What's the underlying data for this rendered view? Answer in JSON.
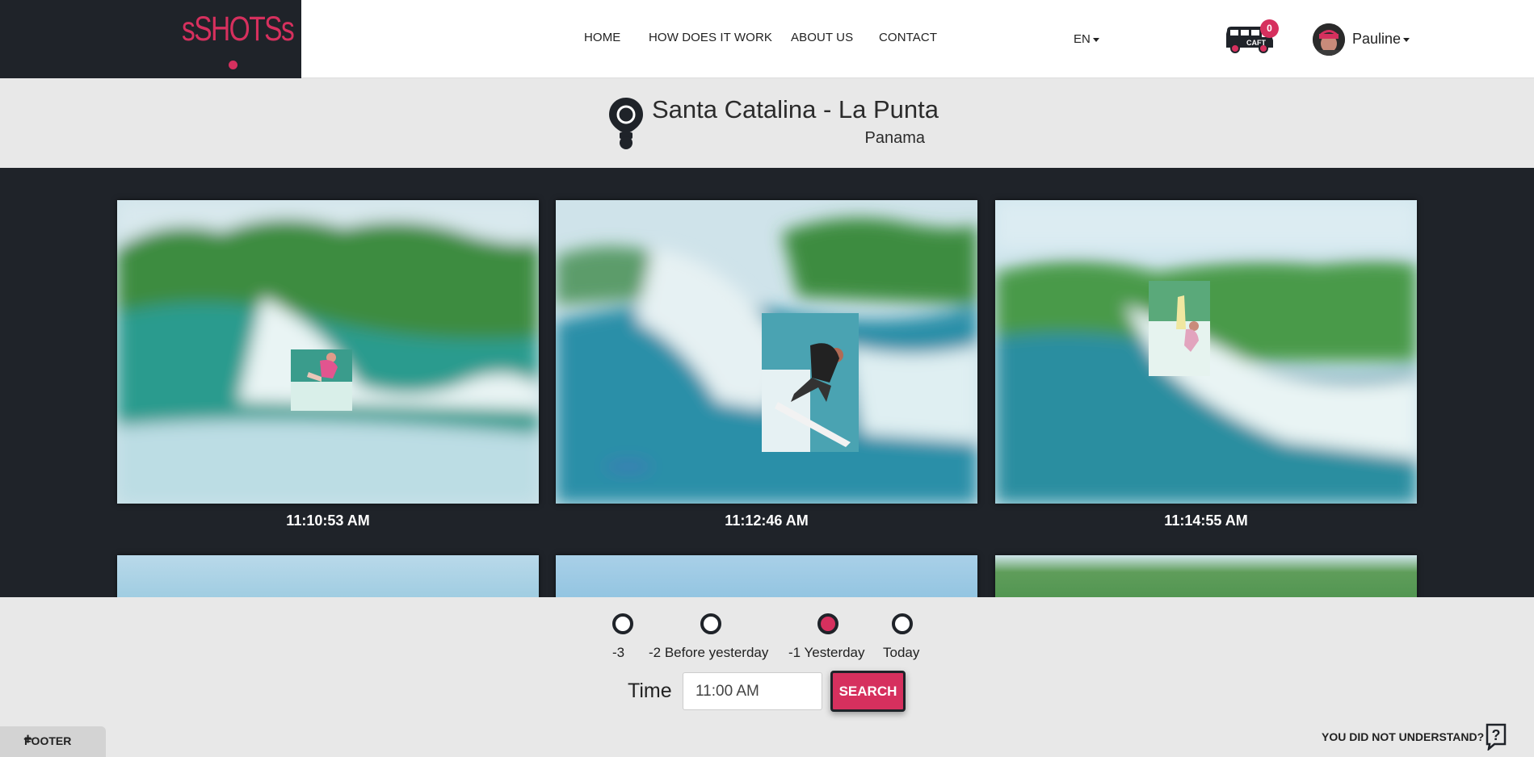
{
  "brand": {
    "logo_text": "sSHOTSs",
    "accent": "#d6305e",
    "dark": "#1f2329"
  },
  "nav": [
    {
      "label": "HOME"
    },
    {
      "label": "HOW DOES IT WORK"
    },
    {
      "label": "ABOUT US"
    },
    {
      "label": "CONTACT"
    }
  ],
  "language": {
    "selected": "EN"
  },
  "cart": {
    "icon": "van-cart-icon",
    "van_text": "CAFT",
    "count": "0"
  },
  "user": {
    "name": "Pauline",
    "avatar": "user-avatar"
  },
  "location": {
    "icon": "map-pin-icon",
    "title": "Santa Catalina - La Punta",
    "country": "Panama"
  },
  "photos": [
    {
      "time": "11:10:53 AM"
    },
    {
      "time": "11:12:46 AM"
    },
    {
      "time": "11:14:55 AM"
    }
  ],
  "days": [
    {
      "label": "-3",
      "selected": false
    },
    {
      "label": "-2 Before yesterday",
      "selected": false
    },
    {
      "label": "-1 Yesterday",
      "selected": true
    },
    {
      "label": "Today",
      "selected": false
    }
  ],
  "search": {
    "time_label": "Time",
    "time_value": "11:00 AM",
    "button_label": "SEARCH"
  },
  "footer": {
    "label": "FOOTER",
    "icon": "plus-icon"
  },
  "help": {
    "label": "YOU DID NOT UNDERSTAND?",
    "icon": "question-icon"
  }
}
